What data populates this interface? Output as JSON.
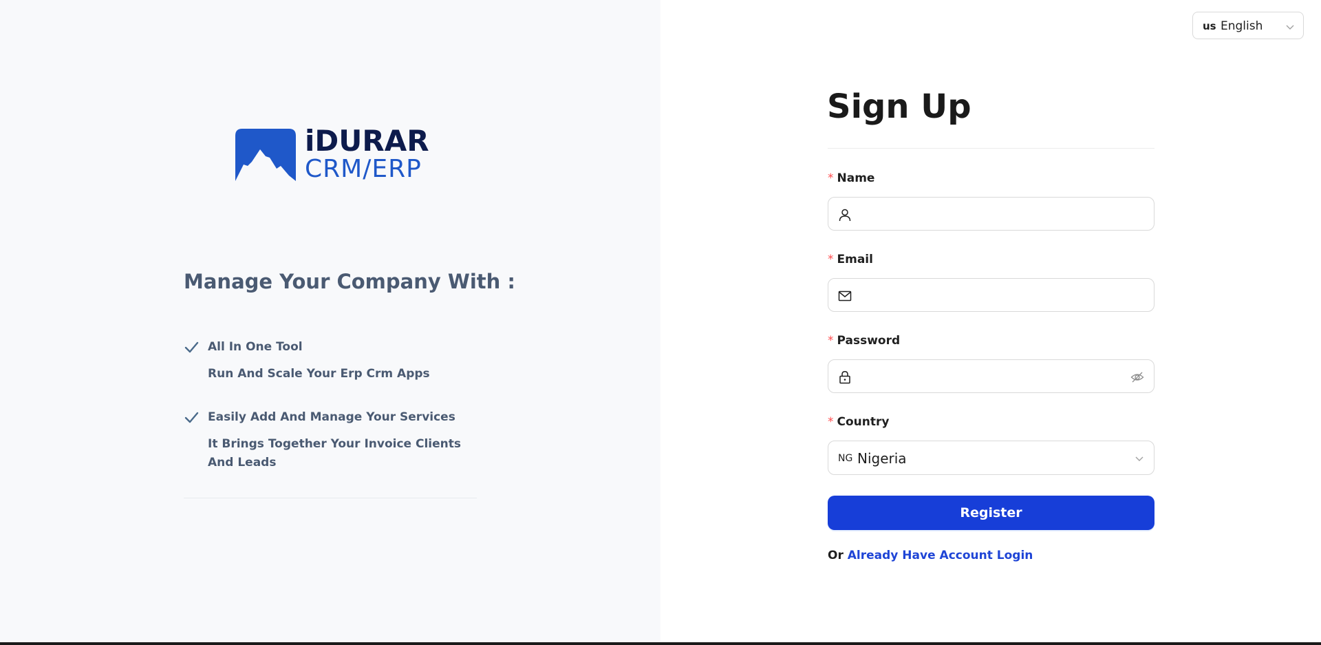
{
  "language": {
    "flag": "us",
    "label": "English"
  },
  "brand": {
    "title": "iDURAR",
    "subtitle": "CRM/ERP"
  },
  "marketing": {
    "title": "Manage Your Company With :",
    "features": [
      {
        "title": "All In One Tool",
        "description": "Run And Scale Your Erp Crm Apps"
      },
      {
        "title": "Easily Add And Manage Your Services",
        "description": "It Brings Together Your Invoice Clients And Leads"
      }
    ]
  },
  "form": {
    "title": "Sign Up",
    "required_mark": "*",
    "name": {
      "label": "Name",
      "value": ""
    },
    "email": {
      "label": "Email",
      "value": ""
    },
    "password": {
      "label": "Password",
      "value": ""
    },
    "country": {
      "label": "Country",
      "flag": "NG",
      "value": "Nigeria"
    },
    "register_label": "Register",
    "login_prefix": "Or",
    "login_link": "Already Have Account Login"
  },
  "colors": {
    "primary": "#173ed8",
    "link": "#1f45d6",
    "required": "#ff4d4f",
    "left_bg": "#f8f9fb",
    "brand_dark": "#0d1b4c",
    "brand_blue": "#1f58c9"
  },
  "icons": {
    "name_field": "user-icon",
    "email_field": "mail-icon",
    "password_field": "lock-icon",
    "password_toggle": "eye-invisible-icon",
    "select_arrow": "chevron-down-icon",
    "feature_bullet": "check-icon"
  }
}
